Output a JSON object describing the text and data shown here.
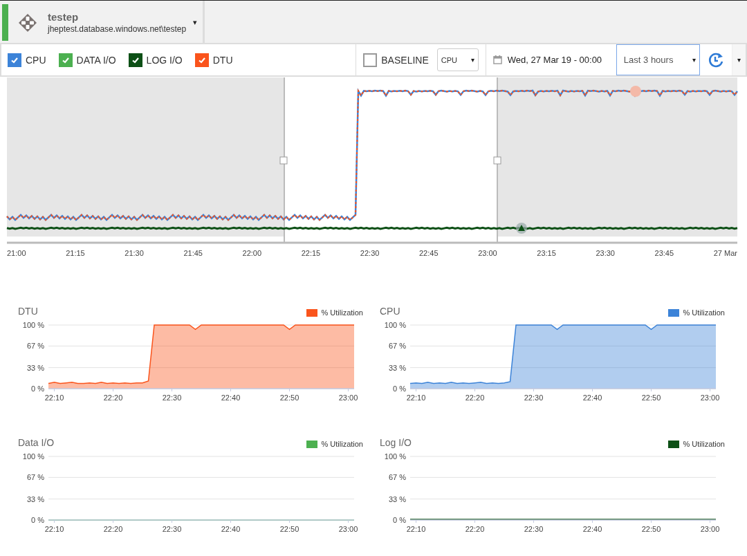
{
  "database": {
    "name": "testep",
    "server": "jheptest.database.windows.net\\testep",
    "dropdown": "▾"
  },
  "toolbar": {
    "metrics": [
      {
        "label": "CPU",
        "checked": true,
        "color": "#3c83d8"
      },
      {
        "label": "DATA I/O",
        "checked": true,
        "color": "#4cb050"
      },
      {
        "label": "LOG I/O",
        "checked": true,
        "color": "#0d5016"
      },
      {
        "label": "DTU",
        "checked": true,
        "color": "#fa541c"
      }
    ],
    "baseline": {
      "label": "BASELINE",
      "checked": false
    },
    "baseline_metric": {
      "value": "CPU",
      "caret": "▾"
    },
    "date": "Wed, 27 Mar 19 - 00:00",
    "range": {
      "value": "Last 3 hours",
      "caret": "▾"
    },
    "more_caret": "▾"
  },
  "overview": {
    "time_labels": [
      "21:00",
      "21:15",
      "21:30",
      "21:45",
      "22:00",
      "22:15",
      "22:30",
      "22:45",
      "23:00",
      "23:15",
      "23:30",
      "23:45",
      "27 Mar"
    ]
  },
  "charts": [
    {
      "title": "DTU",
      "chart_data": {
        "type": "area",
        "ylim": [
          0,
          100
        ],
        "yticks": [
          {
            "value": 0,
            "label": "0 %"
          },
          {
            "value": 33,
            "label": "33 %"
          },
          {
            "value": 67,
            "label": "67 %"
          },
          {
            "value": 100,
            "label": "100 %"
          }
        ],
        "categories": [
          null,
          "22:10",
          null,
          null,
          null,
          null,
          null,
          null,
          null,
          null,
          null,
          "22:20",
          null,
          null,
          null,
          null,
          null,
          null,
          null,
          null,
          null,
          "22:30",
          null,
          null,
          null,
          null,
          null,
          null,
          null,
          null,
          null,
          "22:40",
          null,
          null,
          null,
          null,
          null,
          null,
          null,
          null,
          null,
          "22:50",
          null,
          null,
          null,
          null,
          null,
          null,
          null,
          null,
          null,
          "23:00",
          null
        ],
        "series": [
          {
            "name": "% Utilization",
            "color": "#fa541c",
            "values": [
              8,
              10,
              8,
              9,
              10,
              8,
              8,
              9,
              8,
              10,
              8,
              9,
              8,
              9,
              8,
              9,
              9,
              12,
              100,
              100,
              100,
              100,
              100,
              100,
              100,
              93,
              100,
              100,
              100,
              100,
              100,
              100,
              100,
              100,
              100,
              100,
              100,
              100,
              100,
              100,
              100,
              93,
              100,
              100,
              100,
              100,
              100,
              100,
              100,
              100,
              100,
              100,
              100
            ]
          }
        ]
      }
    },
    {
      "title": "CPU",
      "chart_data": {
        "type": "area",
        "ylim": [
          0,
          100
        ],
        "yticks": [
          {
            "value": 0,
            "label": "0 %"
          },
          {
            "value": 33,
            "label": "33 %"
          },
          {
            "value": 67,
            "label": "67 %"
          },
          {
            "value": 100,
            "label": "100 %"
          }
        ],
        "categories": [
          null,
          "22:10",
          null,
          null,
          null,
          null,
          null,
          null,
          null,
          null,
          null,
          "22:20",
          null,
          null,
          null,
          null,
          null,
          null,
          null,
          null,
          null,
          "22:30",
          null,
          null,
          null,
          null,
          null,
          null,
          null,
          null,
          null,
          "22:40",
          null,
          null,
          null,
          null,
          null,
          null,
          null,
          null,
          null,
          "22:50",
          null,
          null,
          null,
          null,
          null,
          null,
          null,
          null,
          null,
          "23:00",
          null
        ],
        "series": [
          {
            "name": "% Utilization",
            "color": "#3c83d8",
            "values": [
              8,
              9,
              8,
              10,
              8,
              9,
              8,
              10,
              8,
              9,
              8,
              9,
              10,
              8,
              9,
              8,
              9,
              11,
              100,
              100,
              100,
              100,
              100,
              100,
              100,
              93,
              100,
              100,
              100,
              100,
              100,
              100,
              100,
              100,
              100,
              100,
              100,
              100,
              100,
              100,
              100,
              93,
              100,
              100,
              100,
              100,
              100,
              100,
              100,
              100,
              100,
              100,
              100
            ]
          }
        ]
      }
    },
    {
      "title": "Data I/O",
      "chart_data": {
        "type": "line",
        "ylim": [
          0,
          100
        ],
        "yticks": [
          {
            "value": 0,
            "label": "0 %"
          },
          {
            "value": 33,
            "label": "33 %"
          },
          {
            "value": 67,
            "label": "67 %"
          },
          {
            "value": 100,
            "label": "100 %"
          }
        ],
        "categories": [
          null,
          "22:10",
          null,
          null,
          null,
          null,
          null,
          null,
          null,
          null,
          null,
          "22:20",
          null,
          null,
          null,
          null,
          null,
          null,
          null,
          null,
          null,
          "22:30",
          null,
          null,
          null,
          null,
          null,
          null,
          null,
          null,
          null,
          "22:40",
          null,
          null,
          null,
          null,
          null,
          null,
          null,
          null,
          null,
          "22:50",
          null,
          null,
          null,
          null,
          null,
          null,
          null,
          null,
          null,
          "23:00",
          null
        ],
        "series": [
          {
            "name": "% Utilization",
            "color": "#4cb050",
            "values": [
              0,
              0,
              0,
              0,
              0,
              0,
              0,
              0,
              0,
              0,
              0,
              0,
              0,
              0,
              0,
              0,
              0,
              0,
              0,
              0,
              0,
              0,
              0,
              0,
              0,
              0,
              0,
              0,
              0,
              0,
              0,
              0,
              0,
              0,
              0,
              0,
              0,
              0,
              0,
              0,
              0,
              0,
              0,
              0,
              0,
              0,
              0,
              0,
              0,
              0,
              0,
              0,
              0
            ]
          }
        ]
      }
    },
    {
      "title": "Log I/O",
      "chart_data": {
        "type": "area",
        "ylim": [
          0,
          100
        ],
        "yticks": [
          {
            "value": 0,
            "label": "0 %"
          },
          {
            "value": 33,
            "label": "33 %"
          },
          {
            "value": 67,
            "label": "67 %"
          },
          {
            "value": 100,
            "label": "100 %"
          }
        ],
        "categories": [
          null,
          "22:10",
          null,
          null,
          null,
          null,
          null,
          null,
          null,
          null,
          null,
          "22:20",
          null,
          null,
          null,
          null,
          null,
          null,
          null,
          null,
          null,
          "22:30",
          null,
          null,
          null,
          null,
          null,
          null,
          null,
          null,
          null,
          "22:40",
          null,
          null,
          null,
          null,
          null,
          null,
          null,
          null,
          null,
          "22:50",
          null,
          null,
          null,
          null,
          null,
          null,
          null,
          null,
          null,
          "23:00",
          null
        ],
        "series": [
          {
            "name": "% Utilization",
            "color": "#0d5016",
            "values": [
              1,
              1,
              1,
              1,
              1,
              1,
              1,
              1,
              1,
              1,
              1,
              1,
              1,
              1,
              1,
              1,
              1,
              1,
              1,
              1,
              1,
              1,
              1,
              1,
              1,
              1,
              1,
              1,
              1,
              1,
              1,
              1,
              1,
              1,
              1,
              1,
              1,
              1,
              1,
              1,
              1,
              1,
              1,
              1,
              1,
              1,
              1,
              1,
              1,
              1,
              1,
              1,
              1
            ]
          }
        ]
      }
    }
  ]
}
